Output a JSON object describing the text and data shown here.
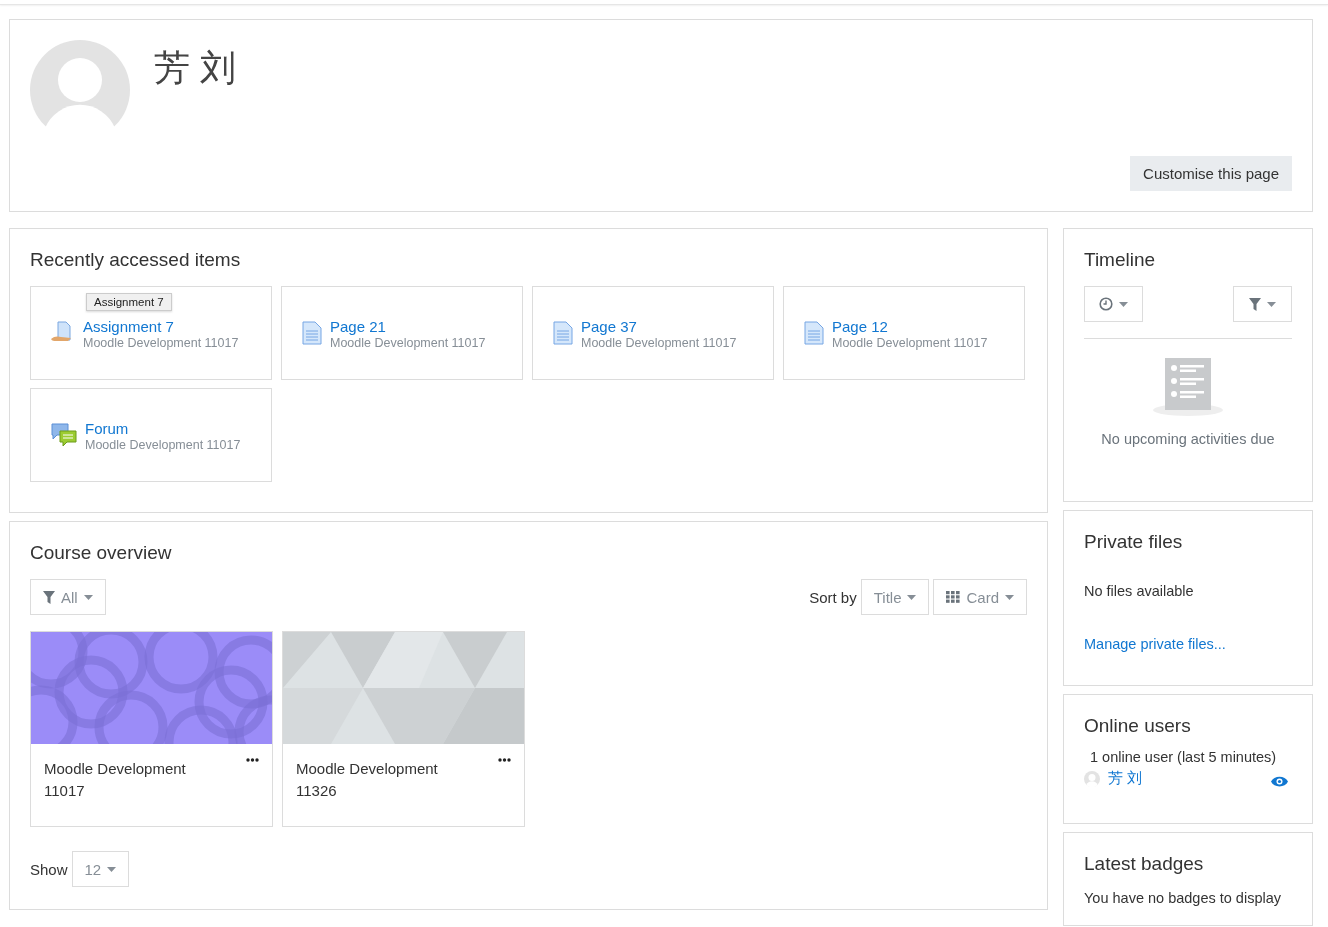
{
  "header": {
    "name": "芳 刘",
    "customise_button": "Customise this page"
  },
  "recent": {
    "title": "Recently accessed items",
    "items": [
      {
        "kind": "assignment",
        "title": "Assignment 7",
        "course": "Moodle Development 11017",
        "tooltip": "Assignment 7"
      },
      {
        "kind": "page",
        "title": "Page 21",
        "course": "Moodle Development 11017"
      },
      {
        "kind": "page",
        "title": "Page 37",
        "course": "Moodle Development 11017"
      },
      {
        "kind": "page",
        "title": "Page 12",
        "course": "Moodle Development 11017"
      },
      {
        "kind": "forum",
        "title": "Forum",
        "course": "Moodle Development 11017"
      }
    ]
  },
  "course_overview": {
    "title": "Course overview",
    "filter": "All",
    "sort_label": "Sort by",
    "sort": "Title",
    "view": "Card",
    "courses": [
      {
        "name": "Moodle Development 11017",
        "kind": "picture"
      },
      {
        "name": "Moodle Development 11326",
        "kind": "picture"
      }
    ],
    "show_label": "Show",
    "show": "12"
  },
  "timeline": {
    "title": "Timeline",
    "empty": "No upcoming activities due"
  },
  "private_files": {
    "title": "Private files",
    "empty": "No files available",
    "link": "Manage private files..."
  },
  "online_users": {
    "title": "Online users",
    "summary": "1 online user (last 5 minutes)",
    "users": [
      {
        "name": "芳 刘"
      }
    ]
  },
  "latest_badges": {
    "title": "Latest badges",
    "empty": "You have no badges to display"
  }
}
